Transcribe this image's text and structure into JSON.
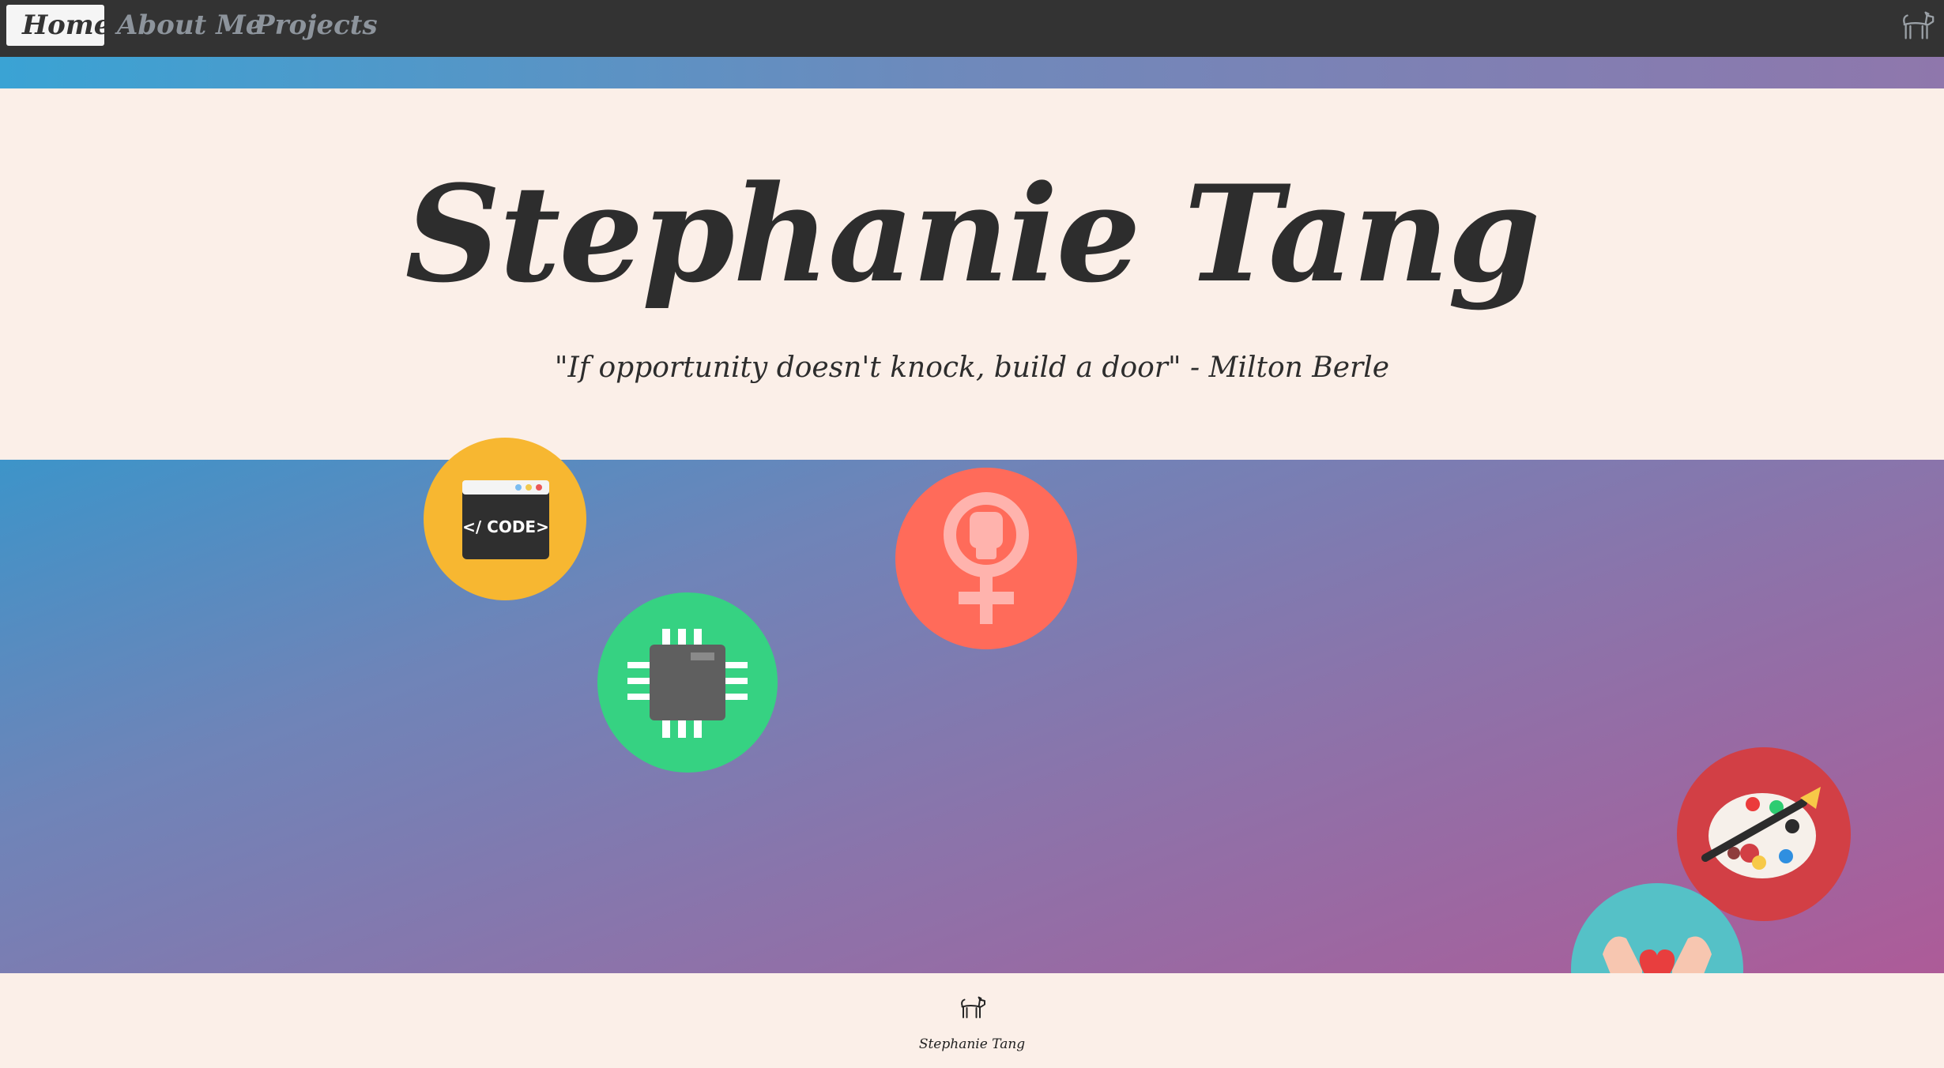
{
  "nav": {
    "items": [
      {
        "label": "Home",
        "active": true
      },
      {
        "label": "About Me",
        "active": false
      },
      {
        "label": "Projects",
        "active": false
      }
    ],
    "logo_icon": "dog-icon"
  },
  "hero": {
    "title": "Stephanie Tang",
    "quote": "\"If opportunity doesn't knock, build a door\" - Milton Berle"
  },
  "band": {
    "icons": [
      {
        "name": "code-icon",
        "label": "</ CODE>",
        "color": "#f7b731"
      },
      {
        "name": "chip-icon",
        "color": "#36d282"
      },
      {
        "name": "feminism-icon",
        "color": "#ff6b5a"
      },
      {
        "name": "palette-icon",
        "color": "#d23f45"
      },
      {
        "name": "heart-hands-icon",
        "color": "#55c1c7"
      }
    ]
  },
  "footer": {
    "icon": "dog-icon",
    "name": "Stephanie Tang"
  },
  "colors": {
    "navbar": "#333333",
    "background": "#fbefe8",
    "gradient_start": "#3d94c9",
    "gradient_end": "#ad5b98"
  }
}
